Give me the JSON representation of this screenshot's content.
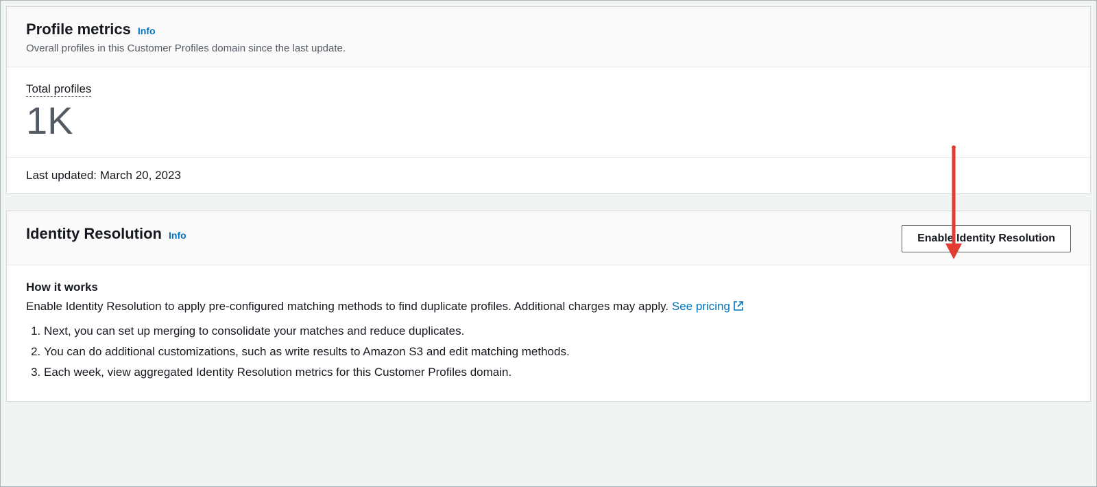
{
  "profile_metrics": {
    "title": "Profile metrics",
    "info_label": "Info",
    "subtitle": "Overall profiles in this Customer Profiles domain since the last update.",
    "total_profiles_label": "Total profiles",
    "total_profiles_value": "1K",
    "last_updated_prefix": "Last updated: ",
    "last_updated_value": "March 20, 2023"
  },
  "identity_resolution": {
    "title": "Identity Resolution",
    "info_label": "Info",
    "enable_button": "Enable Identity Resolution",
    "how_it_works_title": "How it works",
    "how_it_works_desc": "Enable Identity Resolution to apply pre-configured matching methods to find duplicate profiles. Additional charges may apply. ",
    "see_pricing_label": "See pricing",
    "steps": [
      "Next, you can set up merging to consolidate your matches and reduce duplicates.",
      "You can do additional customizations, such as write results to Amazon S3 and edit matching methods.",
      "Each week, view aggregated Identity Resolution metrics for this Customer Profiles domain."
    ]
  }
}
